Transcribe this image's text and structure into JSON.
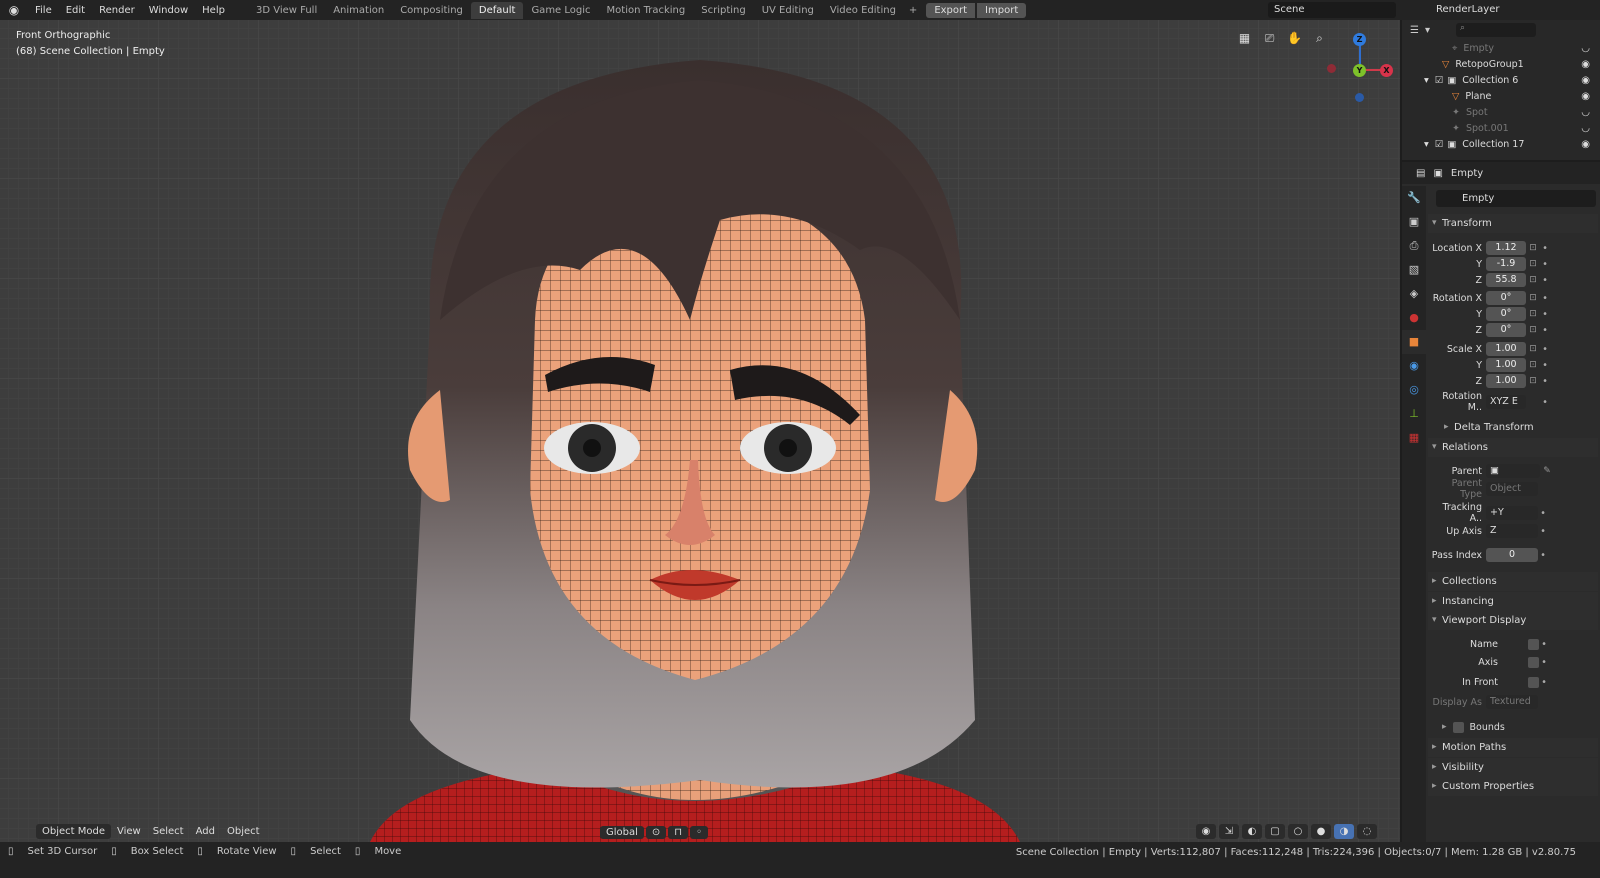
{
  "app": {
    "logo_icon": "blender-logo-icon"
  },
  "menu": [
    "File",
    "Edit",
    "Render",
    "Window",
    "Help"
  ],
  "workspaces": [
    "3D View Full",
    "Animation",
    "Compositing",
    "Default",
    "Game Logic",
    "Motion Tracking",
    "Scripting",
    "UV Editing",
    "Video Editing"
  ],
  "active_workspace": "Default",
  "export_label": "Export",
  "import_label": "Import",
  "scene": "Scene",
  "render_layer": "RenderLayer",
  "viewport": {
    "view_name": "Front Orthographic",
    "collection_info": "(68) Scene Collection | Empty"
  },
  "gizmo": {
    "z": "Z",
    "y": "Y",
    "x": "X"
  },
  "header": {
    "mode": "Object Mode",
    "view": "View",
    "select": "Select",
    "add": "Add",
    "object": "Object",
    "orientation": "Global"
  },
  "outliner": [
    {
      "name": "Empty",
      "type": "empty",
      "dim": true
    },
    {
      "name": "RetopoGroup1",
      "type": "mesh",
      "dim": false
    },
    {
      "name": "Collection 6",
      "type": "collection",
      "dim": false
    },
    {
      "name": "Plane",
      "type": "mesh",
      "dim": false
    },
    {
      "name": "Spot",
      "type": "light",
      "dim": true
    },
    {
      "name": "Spot.001",
      "type": "light",
      "dim": true
    },
    {
      "name": "Collection 17",
      "type": "collection",
      "dim": false
    }
  ],
  "properties": {
    "object_name": "Empty",
    "datablock_name": "Empty",
    "transform_label": "Transform",
    "location": {
      "label": "Location X",
      "x": "1.12",
      "y": "-1.9",
      "z": "55.8"
    },
    "rotation": {
      "label": "Rotation X",
      "x": "0°",
      "y": "0°",
      "z": "0°"
    },
    "scale": {
      "label": "Scale X",
      "x": "1.00",
      "y": "1.00",
      "z": "1.00"
    },
    "axis_labels": {
      "y": "Y",
      "z": "Z"
    },
    "rotation_mode": {
      "label": "Rotation M..",
      "value": "XYZ E"
    },
    "delta_transform": "Delta Transform",
    "relations": "Relations",
    "parent": "Parent",
    "parent_type": {
      "label": "Parent Type",
      "value": "Object"
    },
    "tracking_axis": {
      "label": "Tracking A..",
      "value": "+Y"
    },
    "up_axis": {
      "label": "Up Axis",
      "value": "Z"
    },
    "pass_index": {
      "label": "Pass Index",
      "value": "0"
    },
    "collections": "Collections",
    "instancing": "Instancing",
    "viewport_display": "Viewport Display",
    "name_lbl": "Name",
    "axis_lbl": "Axis",
    "in_front": "In Front",
    "display_as": {
      "label": "Display As",
      "value": "Textured"
    },
    "bounds": "Bounds",
    "motion_paths": "Motion Paths",
    "visibility": "Visibility",
    "custom_properties": "Custom Properties"
  },
  "status": {
    "set_cursor": "Set 3D Cursor",
    "box_select": "Box Select",
    "rotate_view": "Rotate View",
    "select": "Select",
    "move": "Move",
    "stats": "Scene Collection | Empty | Verts:112,807 | Faces:112,248 | Tris:224,396 | Objects:0/7 | Mem: 1.28 GB | v2.80.75"
  }
}
